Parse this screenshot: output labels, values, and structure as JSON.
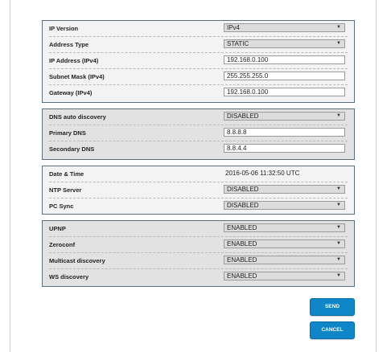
{
  "network": {
    "ip_version_label": "IP Version",
    "ip_version_value": "IPv4",
    "address_type_label": "Address Type",
    "address_type_value": "STATIC",
    "ip_address_label": "IP Address (IPv4)",
    "ip_address_value": "192.168.0.100",
    "subnet_mask_label": "Subnet Mask (IPv4)",
    "subnet_mask_value": "255.255.255.0",
    "gateway_label": "Gateway (IPv4)",
    "gateway_value": "192.168.0.100"
  },
  "dns": {
    "auto_discovery_label": "DNS auto discovery",
    "auto_discovery_value": "DISABLED",
    "primary_label": "Primary DNS",
    "primary_value": "8.8.8.8",
    "secondary_label": "Secondary DNS",
    "secondary_value": "8.8.4.4"
  },
  "time": {
    "datetime_label": "Date & Time",
    "datetime_value": "2016-05-06 11:32:50 UTC",
    "ntp_label": "NTP Server",
    "ntp_value": "DISABLED",
    "pc_sync_label": "PC Sync",
    "pc_sync_value": "DISABLED"
  },
  "discovery": {
    "upnp_label": "UPNP",
    "upnp_value": "ENABLED",
    "zeroconf_label": "Zeroconf",
    "zeroconf_value": "ENABLED",
    "multicast_label": "Multicast discovery",
    "multicast_value": "ENABLED",
    "ws_label": "WS discovery",
    "ws_value": "ENABLED"
  },
  "actions": {
    "send_label": "SEND",
    "cancel_label": "CANCEL"
  },
  "dropdown_arrow_icon": "triangle-down",
  "colors": {
    "button": "#0e86c8",
    "group_border": "#5a6f82"
  }
}
